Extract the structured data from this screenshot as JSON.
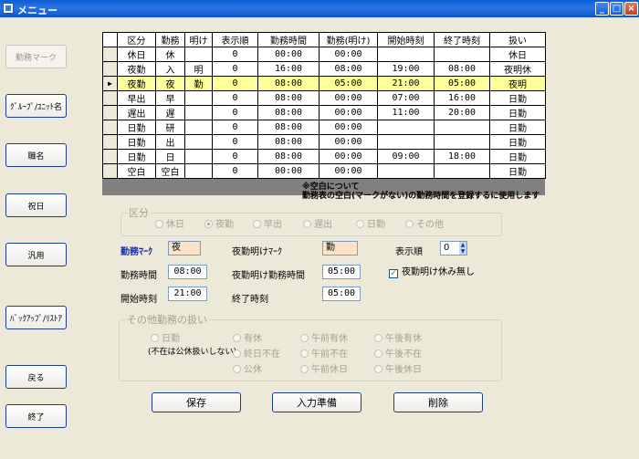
{
  "window": {
    "title": "メニュー",
    "min": "_",
    "max": "□",
    "close": "×"
  },
  "sidebar": {
    "items": [
      {
        "label": "勤務マーク",
        "enabled": false
      },
      {
        "label": "ｸﾞﾙｰﾌﾟ/ﾕﾆｯﾄ名",
        "enabled": true
      },
      {
        "label": "職名",
        "enabled": true
      },
      {
        "label": "祝日",
        "enabled": true
      },
      {
        "label": "汎用",
        "enabled": true
      },
      {
        "label": "ﾊﾞｯｸｱｯﾌﾟ/ﾘｽﾄｱ",
        "enabled": true
      },
      {
        "label": "戻る",
        "enabled": true
      },
      {
        "label": "終了",
        "enabled": true
      }
    ]
  },
  "grid": {
    "columns": [
      "区分",
      "勤務",
      "明け",
      "表示順",
      "勤務時間",
      "勤務(明け)",
      "開始時刻",
      "終了時刻",
      "扱い"
    ],
    "current_row_marker": "▶",
    "rows": [
      [
        "休日",
        "休",
        "",
        "0",
        "00:00",
        "00:00",
        "",
        "",
        "休日"
      ],
      [
        "夜勤",
        "入",
        "明",
        "0",
        "16:00",
        "08:00",
        "19:00",
        "08:00",
        "夜明休"
      ],
      [
        "夜勤",
        "夜",
        "勤",
        "0",
        "08:00",
        "05:00",
        "21:00",
        "05:00",
        "夜明"
      ],
      [
        "早出",
        "早",
        "",
        "0",
        "08:00",
        "00:00",
        "07:00",
        "16:00",
        "日勤"
      ],
      [
        "遅出",
        "遅",
        "",
        "0",
        "08:00",
        "00:00",
        "11:00",
        "20:00",
        "日勤"
      ],
      [
        "日勤",
        "研",
        "",
        "0",
        "08:00",
        "00:00",
        "",
        "",
        "日勤"
      ],
      [
        "日勤",
        "出",
        "",
        "0",
        "08:00",
        "00:00",
        "",
        "",
        "日勤"
      ],
      [
        "日勤",
        "日",
        "",
        "0",
        "08:00",
        "00:00",
        "09:00",
        "18:00",
        "日勤"
      ],
      [
        "空白",
        "空白",
        "",
        "0",
        "00:00",
        "00:00",
        "",
        "",
        "日勤"
      ]
    ],
    "selected_row": 2
  },
  "note": {
    "line1": "※空白について",
    "line2": "勤務表の空白(マークがない)の勤務時間を登録するに使用します"
  },
  "category": {
    "legend": "区分",
    "options": [
      "休日",
      "夜勤",
      "早出",
      "遅出",
      "日勤",
      "その他"
    ],
    "selected": "夜勤"
  },
  "form": {
    "mark_label": "勤務ﾏｰｸ",
    "mark_value": "夜",
    "night_mark_label": "夜勤明けﾏｰｸ",
    "night_mark_value": "勤",
    "order_label": "表示順",
    "order_value": "0",
    "work_time_label": "勤務時間",
    "work_time_value": "08:00",
    "night_work_time_label": "夜勤明け勤務時間",
    "night_work_time_value": "05:00",
    "no_rest_label": "夜勤明け休み無し",
    "no_rest_checked": true,
    "start_label": "開始時刻",
    "start_value": "21:00",
    "end_label": "終了時刻",
    "end_value": "05:00"
  },
  "other": {
    "legend": "その他勤務の扱い",
    "note": "(不在は公休扱いしない)",
    "col1": [
      "日勤"
    ],
    "col2": [
      "有休",
      "終日不在",
      "公休"
    ],
    "col3": [
      "午前有休",
      "午前不在",
      "午前休日"
    ],
    "col4": [
      "午後有休",
      "午後不在",
      "午後休日"
    ]
  },
  "buttons": {
    "save": "保存",
    "prepare": "入力準備",
    "delete": "削除"
  }
}
